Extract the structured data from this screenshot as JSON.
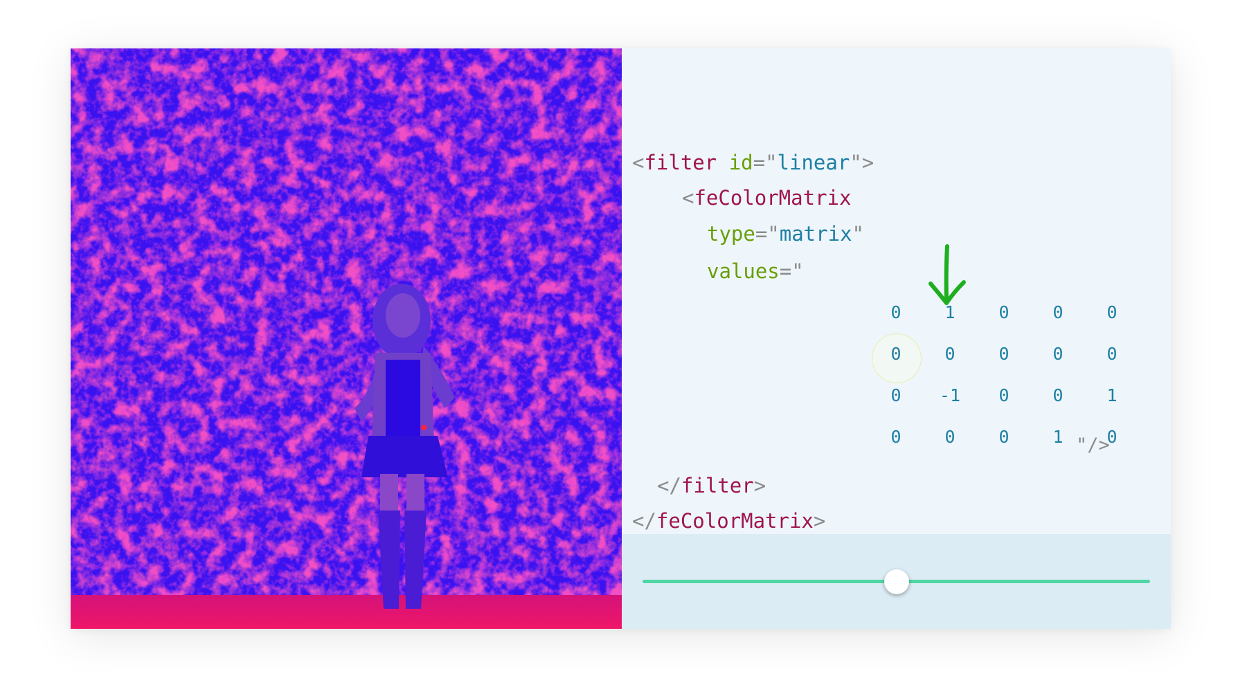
{
  "code": {
    "filter_open": {
      "lt": "<",
      "tag": "filter",
      "attr": "id",
      "eq": "=\"",
      "value": "linear",
      "close": "\">"
    },
    "fecolormatrix_open": {
      "lt": "<",
      "tag": "feColorMatrix"
    },
    "type_attr": {
      "attr": "type",
      "eq": "=\"",
      "value": "matrix",
      "close": "\""
    },
    "values_attr": {
      "attr": "values",
      "eq": "=\""
    },
    "matrix_end": "\"/>",
    "filter_close": {
      "lt": "</",
      "tag": "filter",
      "gt": ">"
    },
    "fecolormatrix_close": {
      "lt": "</",
      "tag": "feColorMatrix",
      "gt": ">"
    }
  },
  "matrix": [
    [
      "0",
      "1",
      "0",
      "0",
      "0"
    ],
    [
      "0",
      "0",
      "0",
      "0",
      "0"
    ],
    [
      "0",
      "-1",
      "0",
      "0",
      "1"
    ],
    [
      "0",
      "0",
      "0",
      "1",
      "0"
    ]
  ],
  "slider": {
    "value": 0.5
  },
  "colors": {
    "tag": "#a0144f",
    "attribute": "#6a9e09",
    "string": "#1f7fa3",
    "punctuation": "#8b8b8b",
    "slider_track": "#4fd6a4",
    "arrow": "#1fae1f",
    "photo_blue": "#3a12f0",
    "photo_magenta": "#e0146e"
  },
  "icons": {
    "arrow": "arrow-down-icon",
    "focus": "focus-ring"
  }
}
